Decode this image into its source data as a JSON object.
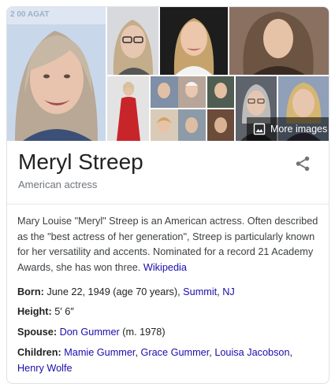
{
  "knowledge_panel": {
    "title": "Meryl Streep",
    "subtitle": "American actress",
    "more_images_label": "More images",
    "watermark_text": "2 00 AGAT",
    "description": "Mary Louise \"Meryl\" Streep is an American actress. Often described as the \"best actress of her generation\", Streep is particularly known for her versatility and accents. Nominated for a record 21 Academy Awards, she has won three.",
    "description_source": "Wikipedia",
    "facts": {
      "born": {
        "label": "Born:",
        "text": "June 22, 1949 (age 70 years),",
        "place_city": "Summit",
        "place_sep": ",",
        "place_state": "NJ"
      },
      "height": {
        "label": "Height:",
        "value": "5′ 6″"
      },
      "spouse": {
        "label": "Spouse:",
        "name": "Don Gummer",
        "detail": "(m. 1978)"
      },
      "children": {
        "label": "Children:",
        "names": [
          "Mamie Gummer",
          "Grace Gummer",
          "Louisa Jacobson",
          "Henry Wolfe"
        ],
        "sep": ","
      }
    }
  },
  "colors": {
    "link": "#1a0dab",
    "title": "#222222",
    "subtitle": "#70757a",
    "border": "#dfe1e5"
  },
  "icons": [
    "share-icon",
    "image-icon"
  ]
}
